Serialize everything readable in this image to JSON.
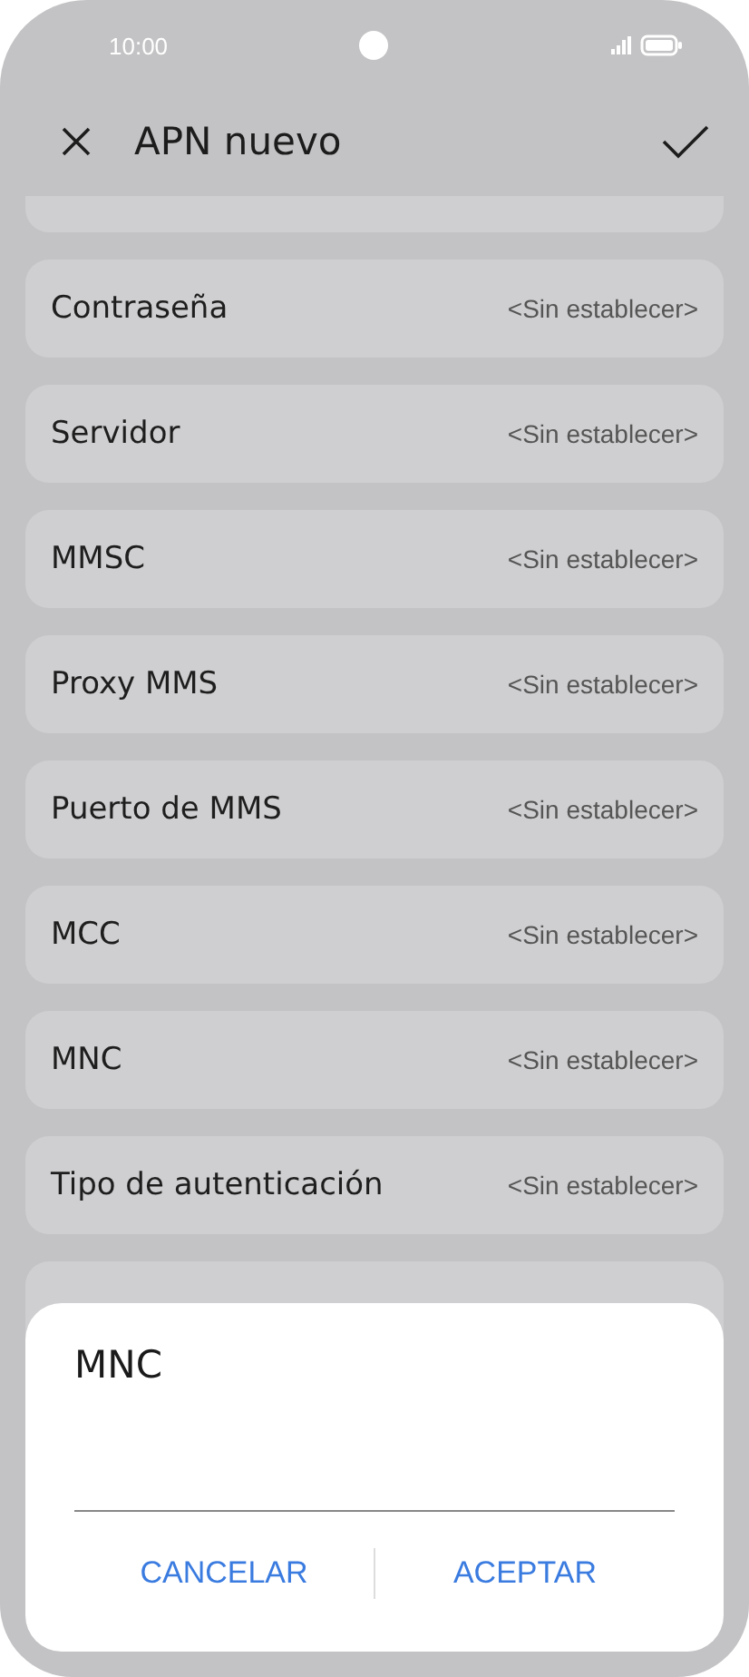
{
  "status_bar": {
    "time": "10:00"
  },
  "header": {
    "title": "APN nuevo"
  },
  "rows": [
    {
      "label": "Contraseña",
      "value": "<Sin establecer>"
    },
    {
      "label": "Servidor",
      "value": "<Sin establecer>"
    },
    {
      "label": "MMSC",
      "value": "<Sin establecer>"
    },
    {
      "label": "Proxy MMS",
      "value": "<Sin establecer>"
    },
    {
      "label": "Puerto de MMS",
      "value": "<Sin establecer>"
    },
    {
      "label": "MCC",
      "value": "<Sin establecer>"
    },
    {
      "label": "MNC",
      "value": "<Sin establecer>"
    },
    {
      "label": "Tipo de autenticación",
      "value": "<Sin establecer>"
    }
  ],
  "dialog": {
    "title": "MNC",
    "buttons": [
      "CANCELAR",
      "ACEPTAR"
    ]
  }
}
